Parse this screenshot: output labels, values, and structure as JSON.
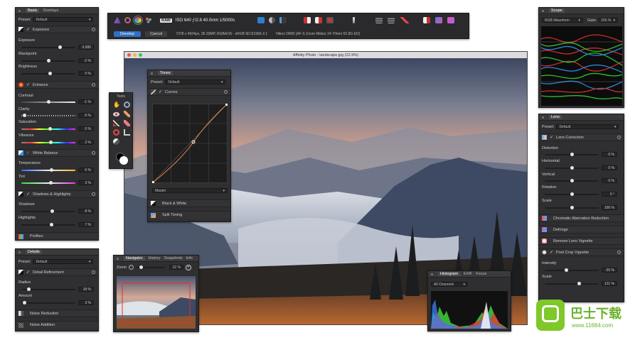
{
  "colors": {
    "panel": "#2f2f31",
    "accent": "#2f7fd1",
    "orange": "#e07a3a"
  },
  "toolbar": {
    "raw": "RAW",
    "exif": "ISO 640 ƒ/2.8 40.0mm 1/5000s",
    "develop": "Develop",
    "cancel": "Cancel",
    "info": "7378 x 4924px, 36.33MP, RGBA/16 - sRGB IEC61966-2.1",
    "camera": "Nikon D800 (AF-S Zoom-Nikkor 24-70mm f/2.8G ED)"
  },
  "window": {
    "title": "Affinity Photo - landscape.jpg (22.9%)"
  },
  "basic": {
    "tabs": [
      "Basic",
      "Overlays"
    ],
    "preset_label": "Preset:",
    "preset": "Default",
    "exposure_section": "Exposure",
    "exposure": {
      "label": "Exposure",
      "value": "0.580"
    },
    "blackpoint": {
      "label": "Blackpoint",
      "value": "-2 %"
    },
    "brightness": {
      "label": "Brightness",
      "value": "0 %"
    },
    "enhance_section": "Enhance",
    "contrast": {
      "label": "Contrast",
      "value": "-1 %"
    },
    "clarity": {
      "label": "Clarity",
      "value": "6 %"
    },
    "saturation": {
      "label": "Saturation",
      "value": "0 %"
    },
    "vibrance": {
      "label": "Vibrance",
      "value": "2 %"
    },
    "wb_section": "White Balance",
    "temperature": {
      "label": "Temperature",
      "value": "6 %"
    },
    "tint": {
      "label": "Tint",
      "value": "3 %"
    },
    "sh_section": "Shadows & Highlights",
    "shadows": {
      "label": "Shadows",
      "value": "8 %"
    },
    "highlights": {
      "label": "Highlights",
      "value": "7 %"
    },
    "profiles": "Profiles"
  },
  "details": {
    "tab": "Details",
    "preset_label": "Preset:",
    "preset": "Default",
    "refinement": "Detail Refinement",
    "radius": {
      "label": "Radius",
      "value": "18 %"
    },
    "amount": {
      "label": "Amount",
      "value": "3 %"
    },
    "noise_reduction": "Noise Reduction",
    "noise_addition": "Noise Addition"
  },
  "tools": {
    "title": "Tools"
  },
  "tones": {
    "tab": "Tones",
    "preset_label": "Preset:",
    "preset": "Default",
    "curves": "Curves",
    "channel": "Master",
    "bw": "Black & White",
    "split": "Split Toning"
  },
  "navigator": {
    "tabs": [
      "Navigator",
      "History",
      "Snapshots",
      "Info"
    ],
    "zoom_label": "Zoom",
    "zoom": "22 %"
  },
  "histogram": {
    "tabs": [
      "Histogram",
      "EXIF",
      "Focus"
    ],
    "channels": "All Channels"
  },
  "scope": {
    "tab": "Scope",
    "mode": "RGB Waveform",
    "gain_label": "Gain:",
    "gain": "200 %"
  },
  "lens": {
    "tab": "Lens",
    "preset_label": "Preset:",
    "preset": "Default",
    "correction": "Lens Correction",
    "distortion": {
      "label": "Distortion",
      "value": "0 %"
    },
    "horizontal": {
      "label": "Horizontal",
      "value": "0 %"
    },
    "vertical": {
      "label": "Vertical",
      "value": "0 %"
    },
    "rotation": {
      "label": "Rotation",
      "value": "0 °"
    },
    "scale": {
      "label": "Scale",
      "value": "100 %"
    },
    "chromatic": "Chromatic Aberration Reduction",
    "defringe": "Defringe",
    "vignette": "Remove Lens Vignette",
    "postcrop": "Post Crop Vignette",
    "intensity": {
      "label": "Intensity",
      "value": "-20 %"
    },
    "scale2": {
      "label": "Scale",
      "value": "121 %"
    }
  },
  "watermark": {
    "text": "巴士下载",
    "url": "www.11684.com"
  }
}
